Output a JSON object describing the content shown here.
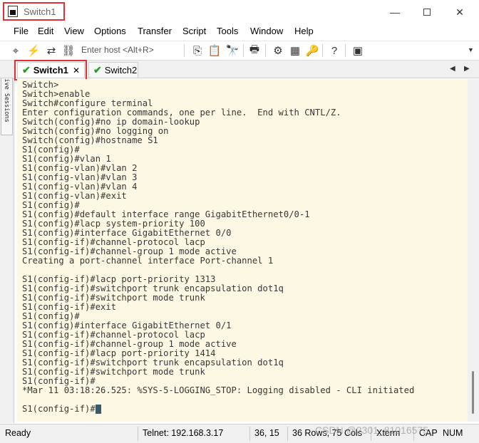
{
  "window": {
    "title": "Switch1",
    "controls": {
      "minimize": "—",
      "close": "✕"
    }
  },
  "menu": [
    "File",
    "Edit",
    "View",
    "Options",
    "Transfer",
    "Script",
    "Tools",
    "Window",
    "Help"
  ],
  "toolbar": {
    "host_placeholder": "Enter host <Alt+R>"
  },
  "tabs": [
    {
      "label": "Switch1",
      "active": true,
      "close": "✕"
    },
    {
      "label": "Switch2",
      "active": false
    }
  ],
  "side_panel": {
    "label": "Active Sessions"
  },
  "terminal": {
    "lines": [
      "Switch>",
      "Switch>enable",
      "Switch#configure terminal",
      "Enter configuration commands, one per line.  End with CNTL/Z.",
      "Switch(config)#no ip domain-lookup",
      "Switch(config)#no logging on",
      "Switch(config)#hostname S1",
      "S1(config)#",
      "S1(config)#vlan 1",
      "S1(config-vlan)#vlan 2",
      "S1(config-vlan)#vlan 3",
      "S1(config-vlan)#vlan 4",
      "S1(config-vlan)#exit",
      "S1(config)#",
      "S1(config)#default interface range GigabitEthernet0/0-1",
      "S1(config)#lacp system-priority 100",
      "S1(config)#interface GigabitEthernet 0/0",
      "S1(config-if)#channel-protocol lacp",
      "S1(config-if)#channel-group 1 mode active",
      "Creating a port-channel interface Port-channel 1",
      "",
      "S1(config-if)#lacp port-priority 1313",
      "S1(config-if)#switchport trunk encapsulation dot1q",
      "S1(config-if)#switchport mode trunk",
      "S1(config-if)#exit",
      "S1(config)#",
      "S1(config)#interface GigabitEthernet 0/1",
      "S1(config-if)#channel-protocol lacp",
      "S1(config-if)#channel-group 1 mode active",
      "S1(config-if)#lacp port-priority 1414",
      "S1(config-if)#switchport trunk encapsulation dot1q",
      "S1(config-if)#switchport mode trunk",
      "S1(config-if)#",
      "*Mar 11 03:18:26.525: %SYS-5-LOGGING_STOP: Logging disabled - CLI initiated",
      "",
      "S1(config-if)#"
    ],
    "colors": {
      "background": "#fdf8e4",
      "text": "#373737"
    }
  },
  "status": {
    "state": "Ready",
    "connection": "Telnet: 192.168.3.17",
    "position": "36,  15",
    "size": "36 Rows, 75 Cols",
    "terminal_type": "Xterm",
    "caps": "CAP",
    "num": "NUM"
  },
  "watermark": "CSDN @2301_81016575",
  "colors": {
    "highlight": "#e03030",
    "check": "#20a020"
  }
}
